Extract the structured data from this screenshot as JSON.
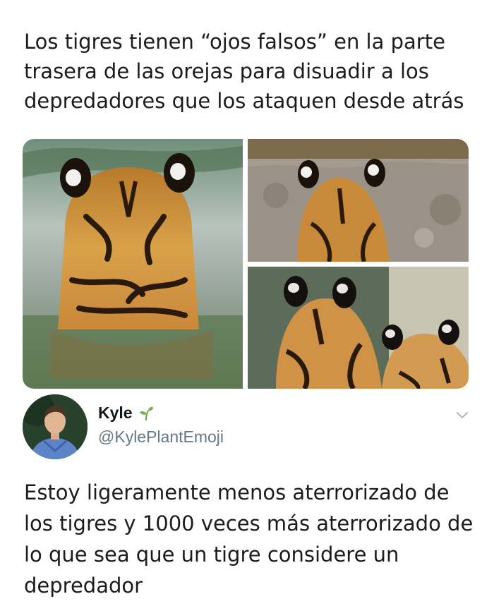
{
  "post": {
    "caption": "Los tigres tienen “ojos falsos” en la parte trasera de las orejas para disuadir a los depredadores que los ataquen desde atrás"
  },
  "tweet": {
    "display_name": "Kyle",
    "name_emoji": "sprout-icon",
    "handle": "@KylePlantEmoji",
    "menu_icon": "chevron-down-icon",
    "text": "Estoy ligeramente menos aterrorizado de los tigres y 1000 veces más aterrorizado de lo que sea que un tigre considere un depredador"
  },
  "colors": {
    "text": "#1c1c1c",
    "handle": "#657786",
    "divider": "#ffffff"
  }
}
